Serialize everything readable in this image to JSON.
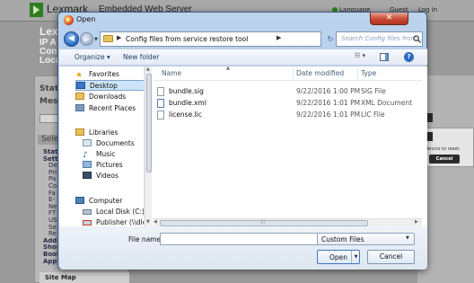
{
  "background": {
    "brand": "Lexmark",
    "title": "Embedded Web Server",
    "language_link": "Language",
    "guest_link": "Guest",
    "login_link": "Log In",
    "info_lines": [
      "Lex",
      "IP A",
      "Cont",
      "Loca"
    ],
    "status_label": "Statu",
    "message_label": "Mess",
    "select_label": "Sele",
    "nav_items": [
      {
        "label": "Statu",
        "bold": true
      },
      {
        "label": "Settin",
        "bold": true
      },
      {
        "label": "De",
        "bold": false
      },
      {
        "label": "Pri",
        "bold": false
      },
      {
        "label": "Pa",
        "bold": false
      },
      {
        "label": "Co",
        "bold": false
      },
      {
        "label": "Fa",
        "bold": false
      },
      {
        "label": "E-",
        "bold": false
      },
      {
        "label": "Ne",
        "bold": false
      },
      {
        "label": "FT",
        "bold": false
      },
      {
        "label": "US",
        "bold": false
      },
      {
        "label": "Se",
        "bold": false
      },
      {
        "label": "Re",
        "bold": false
      },
      {
        "label": "Addr",
        "bold": true
      },
      {
        "label": "Shor",
        "bold": true
      },
      {
        "label": "Book",
        "bold": true
      },
      {
        "label": "Apps",
        "bold": true
      }
    ],
    "sitemap": "Site Map",
    "popup_text": "device to reset.",
    "popup_cancel": "Cancel"
  },
  "dialog": {
    "title": "Open",
    "close_label": "✕",
    "address_path": "Config files from service restore tool",
    "search_placeholder": "Search Config files from...",
    "toolbar": {
      "organize_label": "Organize ▾",
      "new_folder_label": "New folder"
    },
    "nav": {
      "favorites": "Favorites",
      "desktop": "Desktop",
      "downloads": "Downloads",
      "recent_places": "Recent Places",
      "libraries": "Libraries",
      "documents": "Documents",
      "music": "Music",
      "pictures": "Pictures",
      "videos": "Videos",
      "computer": "Computer",
      "local_disk": "Local Disk (C:)",
      "publisher": "Publisher (\\\\dlexx"
    },
    "columns": {
      "name": "Name",
      "date_modified": "Date modified",
      "type": "Type"
    },
    "files": [
      {
        "name": "bundle.sig",
        "date": "9/22/2016 1:00 PM",
        "type": "SIG File"
      },
      {
        "name": "bundle.xml",
        "date": "9/22/2016 1:01 PM",
        "type": "XML Document"
      },
      {
        "name": "license.lic",
        "date": "9/22/2016 1:01 PM",
        "type": "LIC File"
      }
    ],
    "file_name_label": "File name:",
    "file_name_value": "",
    "filter_value": "Custom Files",
    "open_label": "Open",
    "cancel_label": "Cancel"
  }
}
